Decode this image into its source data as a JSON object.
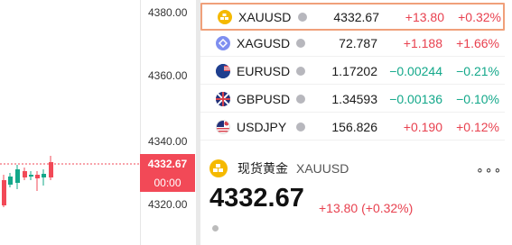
{
  "price_axis": {
    "ticks": [
      "4380.00",
      "4360.00",
      "4340.00",
      "4320.00"
    ],
    "current_price": "4332.67",
    "countdown": "00:00"
  },
  "watchlist": [
    {
      "symbol": "XAUUSD",
      "last": "4332.67",
      "change": "+13.80",
      "percent": "+0.32%",
      "direction": "up",
      "icon": "gold-icon",
      "selected": true
    },
    {
      "symbol": "XAGUSD",
      "last": "72.787",
      "change": "+1.188",
      "percent": "+1.66%",
      "direction": "up",
      "icon": "silver-icon",
      "selected": false
    },
    {
      "symbol": "EURUSD",
      "last": "1.17202",
      "change": "−0.00244",
      "percent": "−0.21%",
      "direction": "down",
      "icon": "eu-us-flag-icon",
      "selected": false
    },
    {
      "symbol": "GBPUSD",
      "last": "1.34593",
      "change": "−0.00136",
      "percent": "−0.10%",
      "direction": "down",
      "icon": "gb-us-flag-icon",
      "selected": false
    },
    {
      "symbol": "USDJPY",
      "last": "156.826",
      "change": "+0.190",
      "percent": "+0.12%",
      "direction": "up",
      "icon": "us-jp-flag-icon",
      "selected": false
    }
  ],
  "detail": {
    "name": "现货黄金",
    "symbol": "XAUUSD",
    "price": "4332.67",
    "change": "+13.80 (+0.32%)",
    "more": "∘∘∘"
  },
  "colors": {
    "up": "#e8414f",
    "down": "#13a88a",
    "gold": "#f5b900",
    "silver": "#7f8ff0",
    "selected_border": "#f0a07a",
    "price_tag": "#f24957"
  }
}
